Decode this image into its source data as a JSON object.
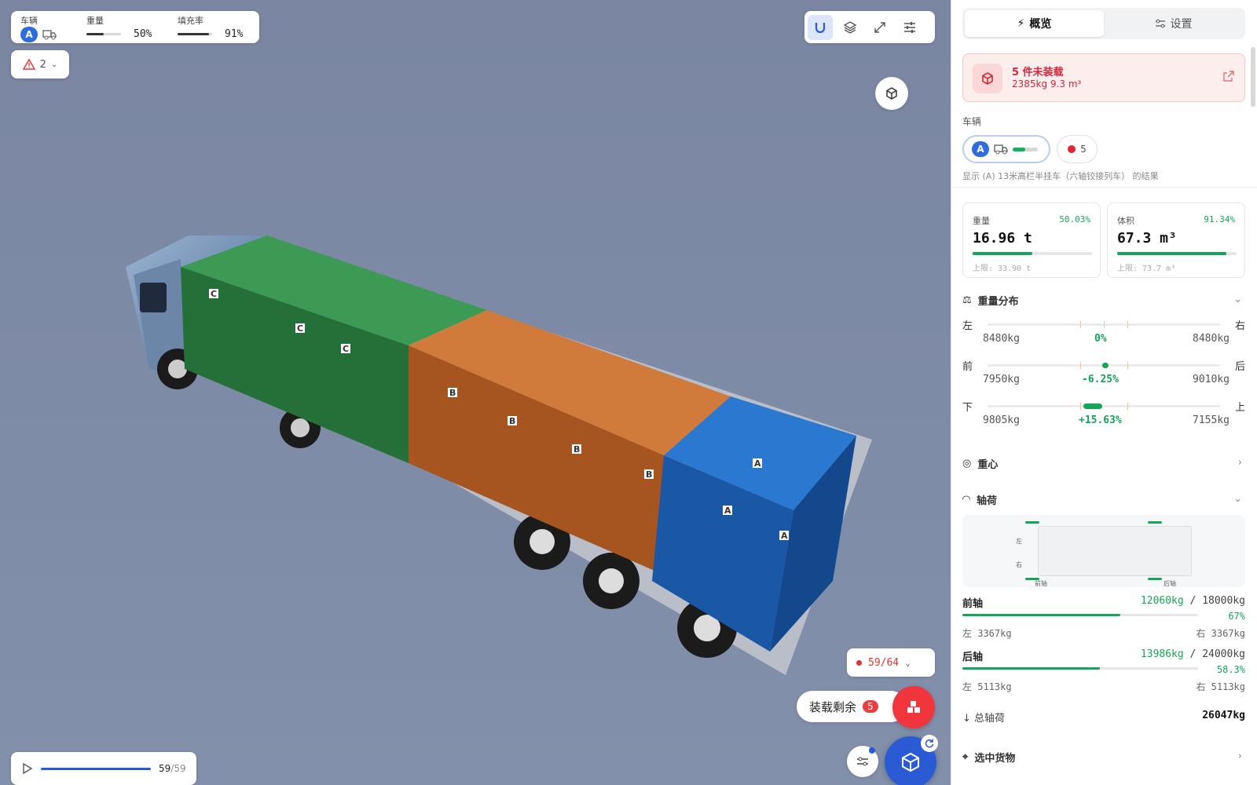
{
  "overlay": {
    "vehicle_label": "车辆",
    "vehicle_badge": "A",
    "weight_label": "重量",
    "weight_value": "50%",
    "weight_fraction": 0.5,
    "fill_label": "填充率",
    "fill_value": "91%",
    "fill_fraction": 0.91,
    "warning_count": "2",
    "progress_text": "59/64",
    "remain_label": "装载剩余",
    "remain_count": "5",
    "player_current": "59",
    "player_total": "/59",
    "toolbar_icons": [
      "magnet-icon",
      "layers-icon",
      "fullscreen-icon",
      "settings-sliders-icon"
    ]
  },
  "scene": {
    "box_labels": {
      "front": "C",
      "middle": "B",
      "rear": "A"
    },
    "colors": {
      "front": "#2f8a47",
      "middle": "#c36a2f",
      "rear": "#1f65b8"
    }
  },
  "panel": {
    "tab_overview": "概览",
    "tab_settings": "设置",
    "alert_title": "5 件未装载",
    "alert_sub": "2385kg   9.3 m³",
    "vehicle_section": "车辆",
    "vehicle_badge": "A",
    "unloaded_count": "5",
    "vehicle_caption": "显示 (A) 13米高栏半挂车（六轴铰接列车） 的结果",
    "weight": {
      "label": "重量",
      "percent": "50.03%",
      "value": "16.96 t",
      "limit": "上限: 33.90 t",
      "fraction": 0.5003
    },
    "volume": {
      "label": "体积",
      "percent": "91.34%",
      "value": "67.3 m³",
      "limit": "上限: 73.7 m³",
      "fraction": 0.9134
    },
    "distribution_title": "重量分布",
    "dist": [
      {
        "l": "左",
        "r": "右",
        "lv": "8480kg",
        "c": "0%",
        "rv": "8480kg"
      },
      {
        "l": "前",
        "r": "后",
        "lv": "7950kg",
        "c": "-6.25%",
        "rv": "9010kg"
      },
      {
        "l": "下",
        "r": "上",
        "lv": "9805kg",
        "c": "+15.63%",
        "rv": "7155kg"
      }
    ],
    "cog_title": "重心",
    "axle_title": "轴荷",
    "axle_diag": {
      "left": "左",
      "right": "右",
      "front": "前轴",
      "rear": "后轴"
    },
    "front_axle": {
      "name": "前轴",
      "value": "12060kg",
      "limit": " / 18000kg",
      "pct": "67%",
      "fraction": 0.67,
      "left": "左 3367kg",
      "right": "右 3367kg"
    },
    "rear_axle": {
      "name": "后轴",
      "value": "13986kg",
      "limit": " / 24000kg",
      "pct": "58.3%",
      "fraction": 0.583,
      "left": "左 5113kg",
      "right": "右 5113kg"
    },
    "total_label": "总轴荷",
    "total_value": "26047kg",
    "selected_title": "选中货物"
  }
}
